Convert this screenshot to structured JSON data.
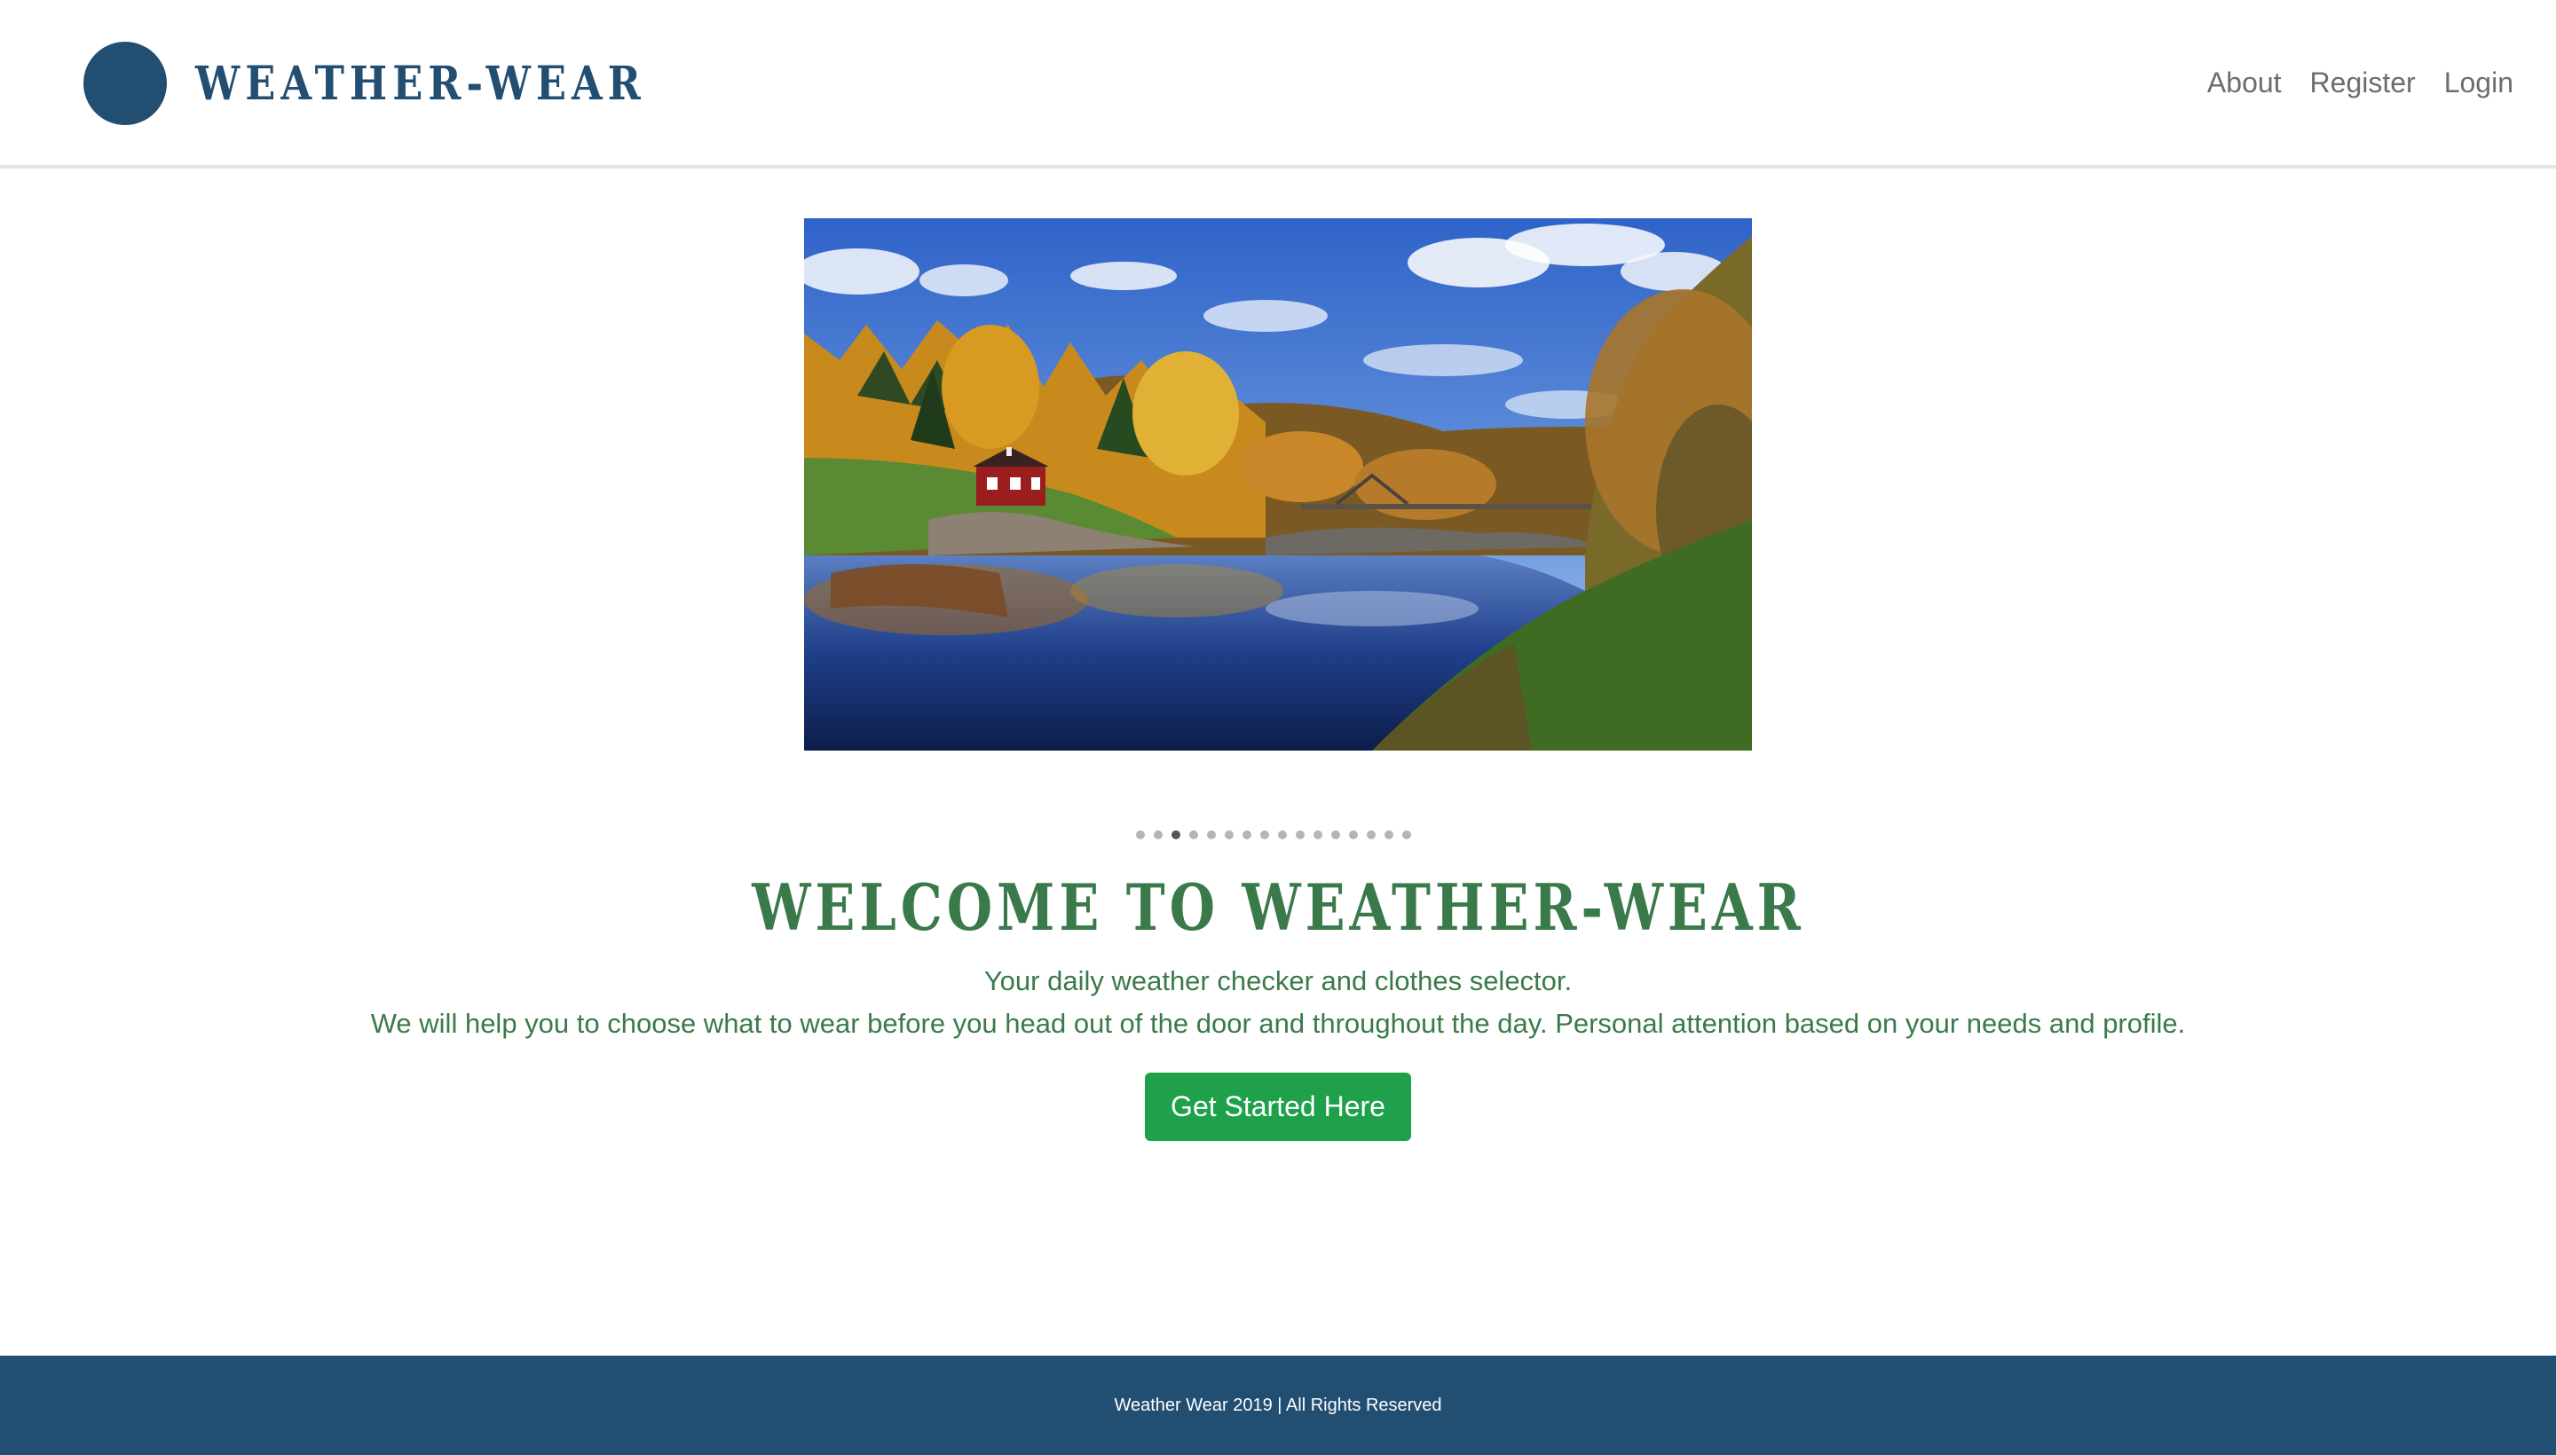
{
  "brand": {
    "name": "WEATHER-WEAR",
    "color": "#224e72"
  },
  "nav": {
    "items": [
      {
        "label": "About"
      },
      {
        "label": "Register"
      },
      {
        "label": "Login"
      }
    ]
  },
  "hero": {
    "image": "autumn-lake-landscape"
  },
  "carousel": {
    "dot_count": 16,
    "active_index": 2
  },
  "welcome": {
    "title": "WELCOME TO WEATHER-WEAR",
    "tagline": "Your daily weather checker and clothes selector.",
    "description": "We will help you to choose what to wear before you head out of the door and throughout the day. Personal attention based on your needs and profile.",
    "cta_label": "Get Started Here",
    "text_color": "#3a7a4a",
    "cta_color": "#1ea14a"
  },
  "footer": {
    "text": "Weather Wear 2019 | All Rights Reserved",
    "background": "#224e72"
  }
}
